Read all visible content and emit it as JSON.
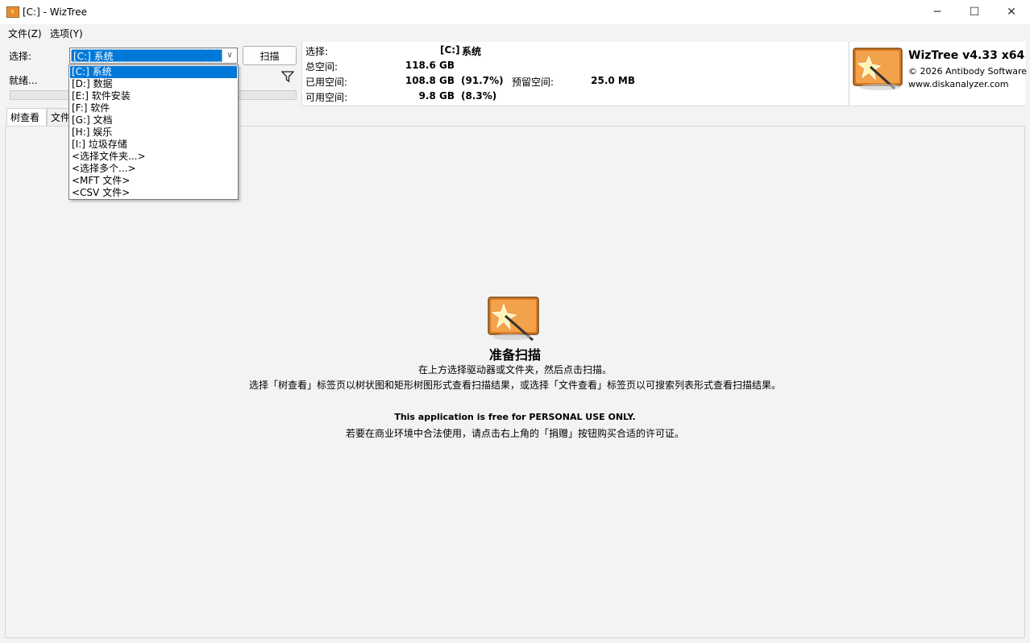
{
  "window": {
    "title": "[C:]  - WizTree",
    "minimize_glyph": "─",
    "maximize_glyph": "☐",
    "close_glyph": "✕"
  },
  "menu": {
    "file": "文件(Z)",
    "options": "选项(Y)"
  },
  "controls": {
    "select_label": "选择:",
    "selected_drive": "[C:] 系统",
    "scan_button": "扫描",
    "status": "就绪...",
    "dropdown_arrow": "∨",
    "progress_fraction": 0
  },
  "dropdown_items": [
    "[C:] 系统",
    "[D:] 数据",
    "[E:] 软件安装",
    "[F:] 软件",
    "[G:] 文档",
    "[H:] 娱乐",
    "[I:] 垃圾存储",
    "<选择文件夹...>",
    "<选择多个...>",
    "<MFT 文件>",
    "<CSV 文件>"
  ],
  "drive_info": {
    "select_label": "选择:",
    "drive_letter": "[C:]",
    "drive_name": "系统",
    "total_label": "总空间:",
    "total_value": "118.6 GB",
    "used_label": "已用空间:",
    "used_value": "108.8 GB",
    "used_pct": "(91.7%)",
    "reserved_label": "预留空间:",
    "reserved_value": "25.0 MB",
    "free_label": "可用空间:",
    "free_value": "9.8 GB",
    "free_pct": "(8.3%)"
  },
  "branding": {
    "product": "WizTree v4.33 x64",
    "copyright": "© 2026 Antibody Software",
    "website": "www.diskanalyzer.com"
  },
  "tabs": {
    "tree_view": "树查看",
    "file_view": "文件"
  },
  "center": {
    "heading": "准备扫描",
    "line1": "在上方选择驱动器或文件夹，然后点击扫描。",
    "line2": "选择「树查看」标签页以树状图和矩形树图形式查看扫描结果，或选择「文件查看」标签页以可搜索列表形式查看扫描结果。",
    "license_notice": "This application is free for PERSONAL USE ONLY.",
    "license_line": "若要在商业环境中合法使用，请点击右上角的「捐赠」按钮购买合适的许可证。"
  },
  "colors": {
    "selection": "#0078d7",
    "background": "#f3f3f3",
    "logo_orange": "#e8892b"
  },
  "icons": {
    "app": "wiztree-logo-icon",
    "filter": "filter-icon"
  }
}
